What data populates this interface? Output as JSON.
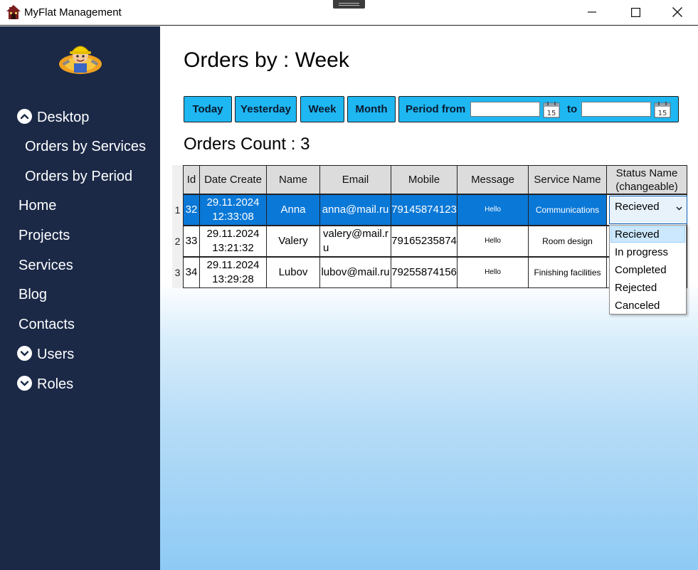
{
  "window": {
    "title": "MyFlat Management",
    "controls": {
      "minimize": "minimize-icon",
      "maximize": "maximize-icon",
      "close": "close-icon"
    }
  },
  "sidebar": {
    "logo": "builder-mascot-logo",
    "items": [
      {
        "label": "Desktop",
        "icon": "chevron-up-circle-icon"
      },
      {
        "label": "Orders by Services"
      },
      {
        "label": "Orders by Period"
      },
      {
        "label": "Home"
      },
      {
        "label": "Projects"
      },
      {
        "label": "Services"
      },
      {
        "label": "Blog"
      },
      {
        "label": "Contacts"
      },
      {
        "label": "Users",
        "icon": "chevron-down-circle-icon"
      },
      {
        "label": "Roles",
        "icon": "chevron-down-circle-icon"
      }
    ]
  },
  "main": {
    "title": "Orders by : Week",
    "toolbar": {
      "today": "Today",
      "yesterday": "Yesterday",
      "week": "Week",
      "month": "Month",
      "period_from": "Period from",
      "to": "to",
      "from_value": "",
      "to_value": "",
      "calendar_icon_text": "15"
    },
    "orders_count": "Orders Count : 3",
    "grid": {
      "headers": [
        "Id",
        "Date Create",
        "Name",
        "Email",
        "Mobile",
        "Message",
        "Service Name",
        "Status Name (changeable)"
      ],
      "rows": [
        {
          "num": "1",
          "id": "32",
          "date": "29.11.2024 12:33:08",
          "name": "Anna",
          "email": "anna@mail.ru",
          "mobile": "79145874123",
          "message": "Hello",
          "service": "Communications",
          "status": "Recieved",
          "selected": true
        },
        {
          "num": "2",
          "id": "33",
          "date": "29.11.2024 13:21:32",
          "name": "Valery",
          "email": "valery@mail.ru",
          "mobile": "79165235874",
          "message": "Hello",
          "service": "Room design",
          "status": ""
        },
        {
          "num": "3",
          "id": "34",
          "date": "29.11.2024 13:29:28",
          "name": "Lubov",
          "email": "lubov@mail.ru",
          "mobile": "79255874156",
          "message": "Hello",
          "service": "Finishing facilities",
          "status": ""
        }
      ]
    },
    "status_options": [
      "Recieved",
      "In progress",
      "Completed",
      "Rejected",
      "Canceled"
    ],
    "status_selected": "Recieved"
  },
  "colors": {
    "sidebar_bg": "#1b2947",
    "button_bg": "#1eb7f2",
    "selected_row": "#0a78d7",
    "header_cell": "#dcdcdc",
    "dropdown_highlight": "#cce8ff"
  }
}
